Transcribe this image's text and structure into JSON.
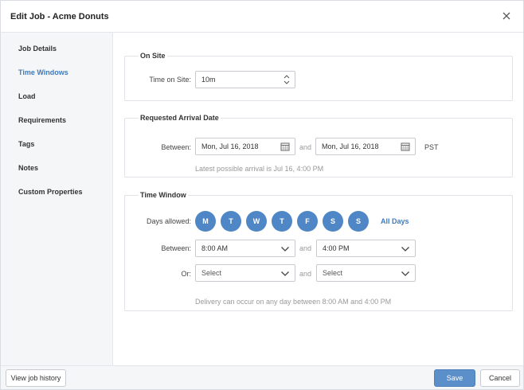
{
  "header": {
    "title": "Edit Job - Acme Donuts"
  },
  "sidebar": {
    "items": [
      {
        "label": "Job Details"
      },
      {
        "label": "Time Windows"
      },
      {
        "label": "Load"
      },
      {
        "label": "Requirements"
      },
      {
        "label": "Tags"
      },
      {
        "label": "Notes"
      },
      {
        "label": "Custom Properties"
      }
    ],
    "active_index": 1
  },
  "on_site": {
    "title": "On Site",
    "time_label": "Time on Site:",
    "time_value": "10m"
  },
  "arrival": {
    "title": "Requested Arrival Date",
    "between_label": "Between:",
    "start_date": "Mon, Jul 16, 2018",
    "and_label": "and",
    "end_date": "Mon, Jul 16, 2018",
    "timezone": "PST",
    "hint": "Latest possible arrival is Jul 16, 4:00 PM"
  },
  "time_window": {
    "title": "Time Window",
    "days_label": "Days allowed:",
    "days": [
      "M",
      "T",
      "W",
      "T",
      "F",
      "S",
      "S"
    ],
    "all_days_label": "All Days",
    "between_label": "Between:",
    "start_time": "8:00 AM",
    "and_label": "and",
    "end_time": "4:00 PM",
    "or_label": "Or:",
    "or_start": "Select",
    "or_end": "Select",
    "hint": "Delivery can occur on any day between 8:00 AM and 4:00 PM"
  },
  "footer": {
    "history_label": "View job history",
    "save_label": "Save",
    "cancel_label": "Cancel"
  },
  "colors": {
    "accent": "#4f86c6",
    "link": "#3d7bbf",
    "save": "#5b8fc9"
  }
}
